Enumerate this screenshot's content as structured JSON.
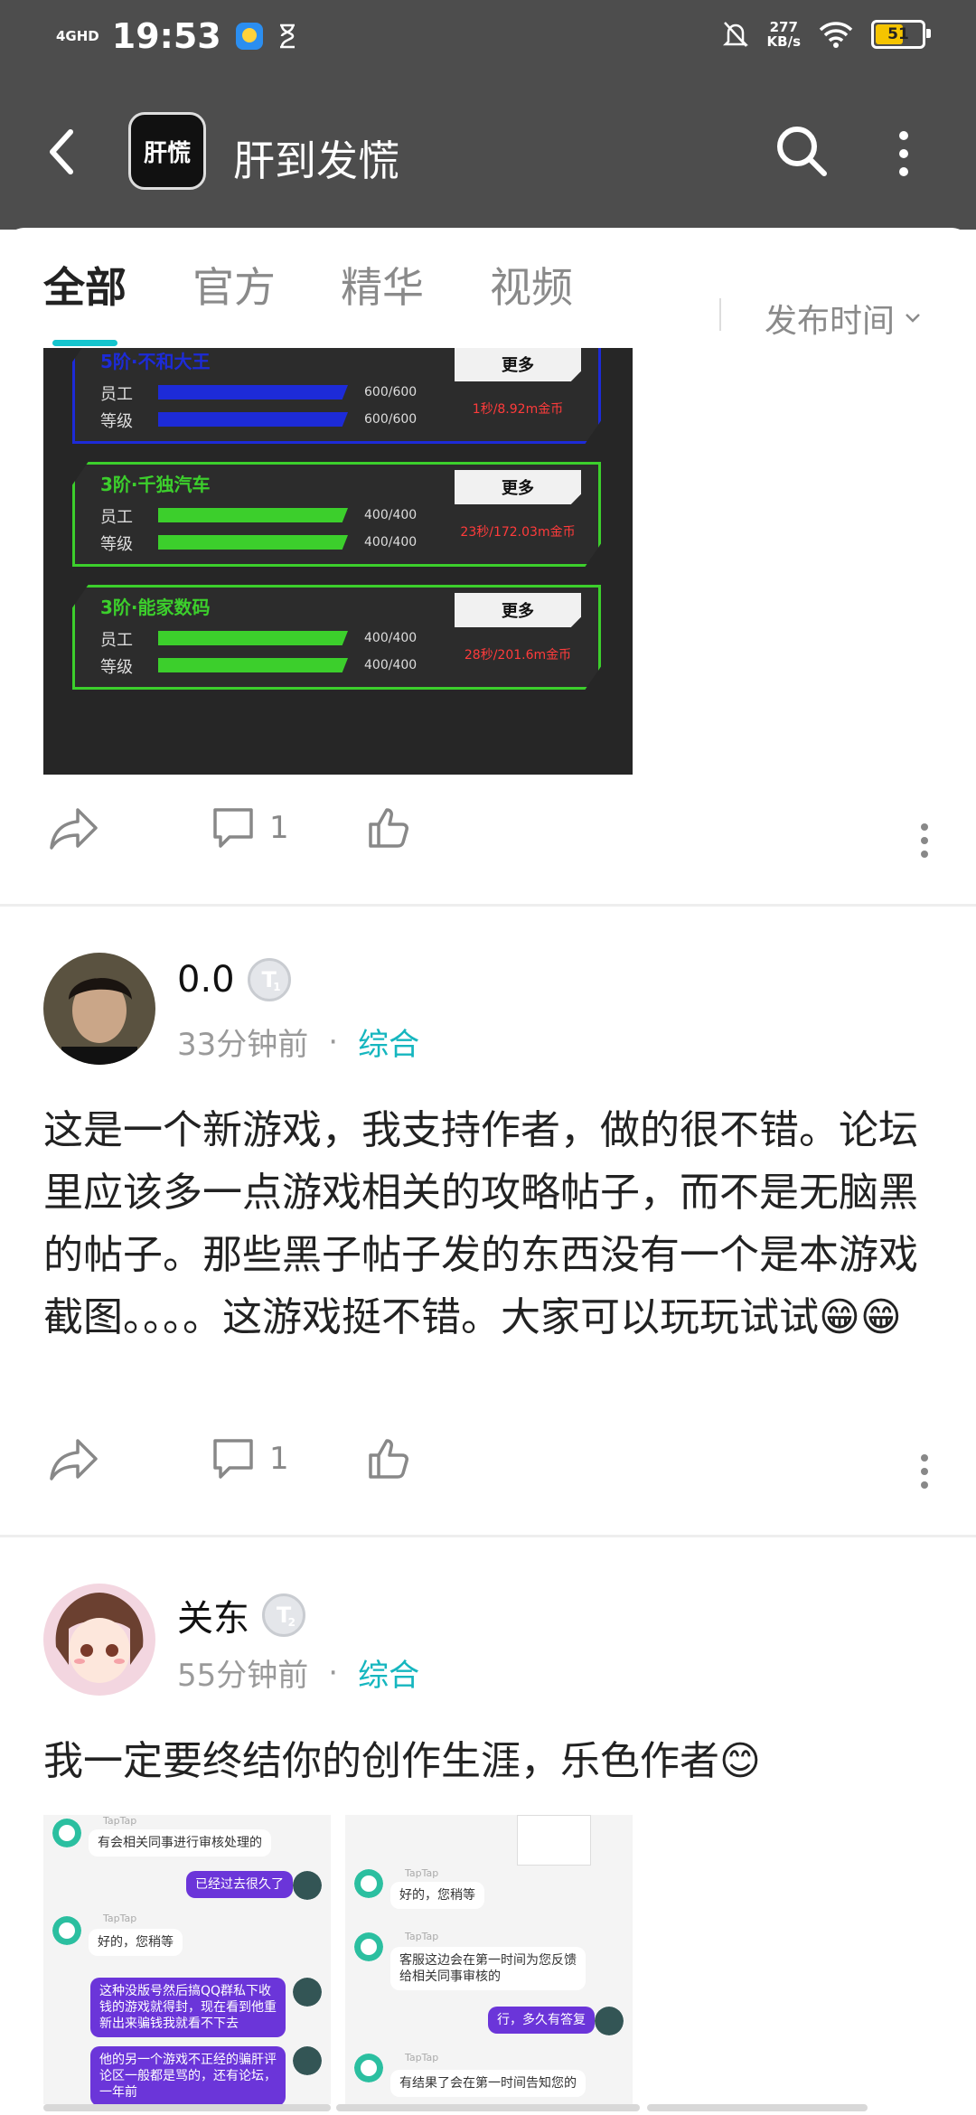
{
  "status_bar": {
    "network": "4GHD",
    "time": "19:53",
    "speed_value": "277",
    "speed_unit": "KB/s",
    "battery": "51"
  },
  "header": {
    "logo_text": "肝慌",
    "title": "肝到发慌"
  },
  "tabs": {
    "items": [
      {
        "label": "全部"
      },
      {
        "label": "官方"
      },
      {
        "label": "精华"
      },
      {
        "label": "视频"
      }
    ],
    "active": "全部",
    "sort_label": "发布时间"
  },
  "game_shot": {
    "cards": [
      {
        "name": "5阶·不和大王",
        "row1": "员工",
        "row2": "等级",
        "val1": "600/600",
        "val2": "600/600",
        "more": "更多",
        "rate": "1秒/8.92m金币",
        "color": "#1d2bd8",
        "fill1": 1.0,
        "fill2": 1.0
      },
      {
        "name": "3阶·千独汽车",
        "row1": "员工",
        "row2": "等级",
        "val1": "400/400",
        "val2": "400/400",
        "more": "更多",
        "rate": "23秒/172.03m金币",
        "color": "#3ccf2c",
        "fill1": 1.0,
        "fill2": 1.0
      },
      {
        "name": "3阶·能家数码",
        "row1": "员工",
        "row2": "等级",
        "val1": "400/400",
        "val2": "400/400",
        "more": "更多",
        "rate": "28秒/201.6m金币",
        "color": "#3ccf2c",
        "fill1": 1.0,
        "fill2": 1.0
      }
    ]
  },
  "post1_actions": {
    "comments": "1"
  },
  "post2": {
    "username": "0.0",
    "badge": "T",
    "level": "1",
    "time_ago": "33分钟前",
    "category": "综合",
    "text": "这是一个新游戏，我支持作者，做的很不错。论坛里应该多一点游戏相关的攻略帖子，而不是无脑黑的帖子。那些黑子帖子发的东西没有一个是本游戏截图。。。。这游戏挺不错。大家可以玩玩试试😁😁",
    "comments": "1"
  },
  "post3": {
    "username": "关东",
    "badge": "T",
    "level": "2",
    "time_ago": "55分钟前",
    "category": "综合",
    "text": "我一定要终结你的创作生涯，乐色作者😊",
    "shot1": {
      "sender": "TapTap",
      "msgs": [
        "有会相关同事进行审核处理的",
        "已经过去很久了",
        "好的，您稍等",
        "这种没版号然后搞QQ群私下收钱的游戏就得封，现在看到他重新出来骗钱我就看不下去",
        "他的另一个游戏不正经的骗肝评论区一般都是骂的，还有论坛，一年前"
      ]
    },
    "shot2": {
      "sender": "TapTap",
      "msgs": [
        "好的，您稍等",
        "客服这边会在第一时间为您反馈给相关同事审核的",
        "行，多久有答复",
        "有结果了会在第一时间告知您的"
      ]
    }
  }
}
